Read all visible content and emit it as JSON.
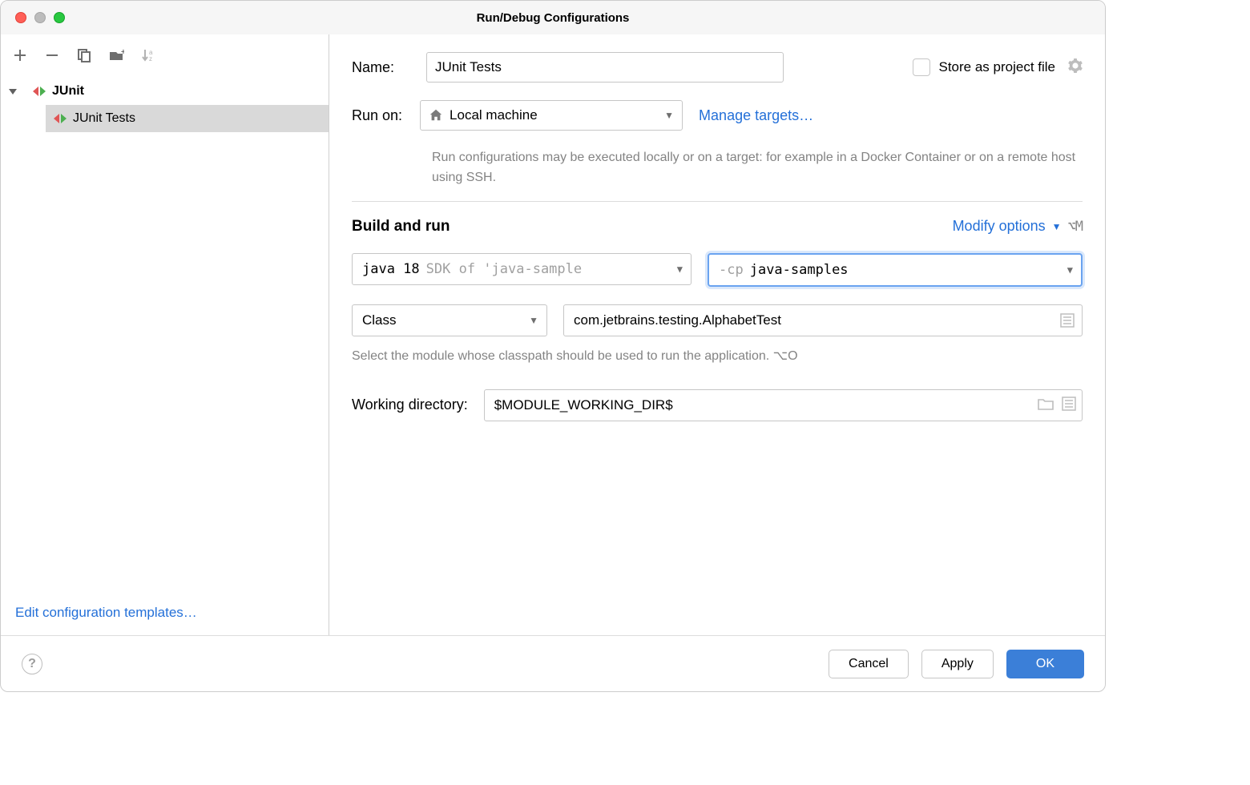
{
  "title": "Run/Debug Configurations",
  "sidebar": {
    "root": {
      "label": "JUnit"
    },
    "items": [
      {
        "label": "JUnit Tests"
      }
    ],
    "edit_templates": "Edit configuration templates…"
  },
  "form": {
    "name_label": "Name:",
    "name_value": "JUnit Tests",
    "store_label": "Store as project file",
    "run_on_label": "Run on:",
    "run_on_value": "Local machine",
    "manage_targets": "Manage targets…",
    "run_on_hint": "Run configurations may be executed locally or on a target: for example in a Docker Container or on a remote host using SSH.",
    "build_and_run": "Build and run",
    "modify_options": "Modify options",
    "modify_shortcut": "⌥M",
    "jre_main": "java 18",
    "jre_sub": "SDK of 'java-sample",
    "cp_flag": "-cp",
    "cp_value": "java-samples",
    "class_label": "Class",
    "class_value": "com.jetbrains.testing.AlphabetTest",
    "class_hint": "Select the module whose classpath should be used to run the application. ⌥O",
    "wd_label": "Working directory:",
    "wd_value": "$MODULE_WORKING_DIR$"
  },
  "buttons": {
    "cancel": "Cancel",
    "apply": "Apply",
    "ok": "OK"
  }
}
